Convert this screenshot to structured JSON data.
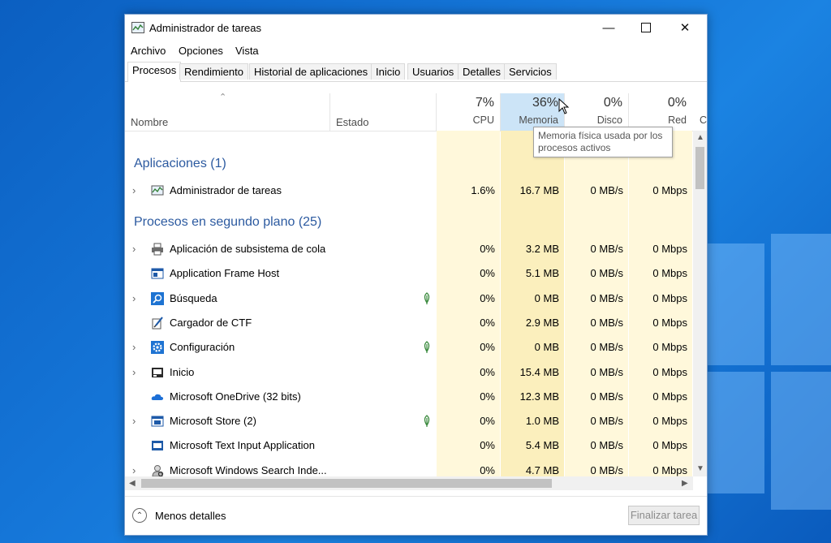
{
  "window": {
    "title": "Administrador de tareas"
  },
  "menu": [
    "Archivo",
    "Opciones",
    "Vista"
  ],
  "tabs": [
    "Procesos",
    "Rendimiento",
    "Historial de aplicaciones",
    "Inicio",
    "Usuarios",
    "Detalles",
    "Servicios"
  ],
  "columns": {
    "name": "Nombre",
    "status": "Estado",
    "cpu_pct": "7%",
    "cpu_label": "CPU",
    "mem_pct": "36%",
    "mem_label": "Memoria",
    "disk_pct": "0%",
    "disk_label": "Disco",
    "net_pct": "0%",
    "net_label": "Red",
    "extra_label": "C"
  },
  "tooltip": {
    "line1": "Memoria física usada por los",
    "line2": "procesos activos"
  },
  "sections": {
    "apps": "Aplicaciones (1)",
    "background": "Procesos en segundo plano (25)"
  },
  "apps": [
    {
      "name": "Administrador de tareas",
      "cpu": "1.6%",
      "mem": "16.7 MB",
      "disk": "0 MB/s",
      "net": "0 Mbps",
      "icon": "task-manager-icon",
      "expandable": true,
      "leaf": false
    }
  ],
  "processes": [
    {
      "name": "Aplicación de subsistema de cola",
      "cpu": "0%",
      "mem": "3.2 MB",
      "disk": "0 MB/s",
      "net": "0 Mbps",
      "icon": "printer-icon",
      "expandable": true,
      "leaf": false
    },
    {
      "name": "Application Frame Host",
      "cpu": "0%",
      "mem": "5.1 MB",
      "disk": "0 MB/s",
      "net": "0 Mbps",
      "icon": "app-frame-icon",
      "expandable": false,
      "leaf": false
    },
    {
      "name": "Búsqueda",
      "cpu": "0%",
      "mem": "0 MB",
      "disk": "0 MB/s",
      "net": "0 Mbps",
      "icon": "search-icon",
      "expandable": true,
      "leaf": true
    },
    {
      "name": "Cargador de CTF",
      "cpu": "0%",
      "mem": "2.9 MB",
      "disk": "0 MB/s",
      "net": "0 Mbps",
      "icon": "ctf-loader-icon",
      "expandable": false,
      "leaf": false
    },
    {
      "name": "Configuración",
      "cpu": "0%",
      "mem": "0 MB",
      "disk": "0 MB/s",
      "net": "0 Mbps",
      "icon": "gear-icon",
      "expandable": true,
      "leaf": true
    },
    {
      "name": "Inicio",
      "cpu": "0%",
      "mem": "15.4 MB",
      "disk": "0 MB/s",
      "net": "0 Mbps",
      "icon": "start-icon",
      "expandable": true,
      "leaf": false
    },
    {
      "name": "Microsoft OneDrive (32 bits)",
      "cpu": "0%",
      "mem": "12.3 MB",
      "disk": "0 MB/s",
      "net": "0 Mbps",
      "icon": "cloud-icon",
      "expandable": false,
      "leaf": false
    },
    {
      "name": "Microsoft Store (2)",
      "cpu": "0%",
      "mem": "1.0 MB",
      "disk": "0 MB/s",
      "net": "0 Mbps",
      "icon": "store-icon",
      "expandable": true,
      "leaf": true
    },
    {
      "name": "Microsoft Text Input Application",
      "cpu": "0%",
      "mem": "5.4 MB",
      "disk": "0 MB/s",
      "net": "0 Mbps",
      "icon": "text-input-icon",
      "expandable": false,
      "leaf": false
    },
    {
      "name": "Microsoft Windows Search Inde...",
      "cpu": "0%",
      "mem": "4.7 MB",
      "disk": "0 MB/s",
      "net": "0 Mbps",
      "icon": "search-indexer-icon",
      "expandable": true,
      "leaf": false
    }
  ],
  "footer": {
    "fewer_details": "Menos detalles",
    "end_task": "Finalizar tarea"
  },
  "colors": {
    "accent": "#2c5aa0",
    "heat_light": "#fff8db",
    "heat_mid": "#fdf0c0",
    "heat_strong": "#f9e7a6",
    "mem_header": "#cce4f7"
  }
}
